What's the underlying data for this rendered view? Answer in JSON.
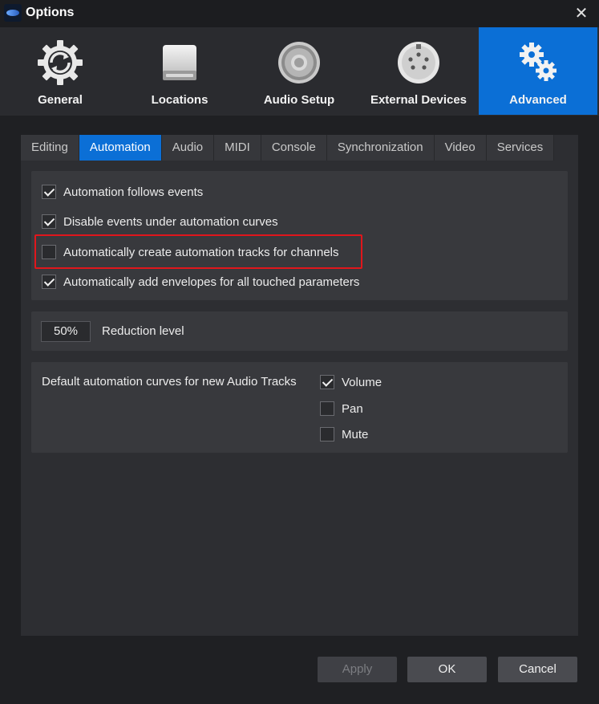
{
  "window": {
    "title": "Options",
    "close_icon": "close-icon"
  },
  "categories": [
    {
      "label": "General",
      "icon": "refresh-gear-icon",
      "active": false
    },
    {
      "label": "Locations",
      "icon": "drive-icon",
      "active": false
    },
    {
      "label": "Audio Setup",
      "icon": "speaker-icon",
      "active": false
    },
    {
      "label": "External Devices",
      "icon": "midi-connector-icon",
      "active": false
    },
    {
      "label": "Advanced",
      "icon": "gears-icon",
      "active": true
    }
  ],
  "tabs": [
    {
      "label": "Editing",
      "active": false
    },
    {
      "label": "Automation",
      "active": true
    },
    {
      "label": "Audio",
      "active": false
    },
    {
      "label": "MIDI",
      "active": false
    },
    {
      "label": "Console",
      "active": false
    },
    {
      "label": "Synchronization",
      "active": false
    },
    {
      "label": "Video",
      "active": false
    },
    {
      "label": "Services",
      "active": false
    }
  ],
  "automation_options": [
    {
      "label": "Automation follows events",
      "checked": true
    },
    {
      "label": "Disable events under automation curves",
      "checked": true
    },
    {
      "label": "Automatically create automation tracks for channels",
      "checked": false
    },
    {
      "label": "Automatically add envelopes for all touched parameters",
      "checked": true
    }
  ],
  "reduction": {
    "value": "50%",
    "label": "Reduction level"
  },
  "default_curves": {
    "label": "Default automation curves for new Audio Tracks",
    "options": [
      {
        "label": "Volume",
        "checked": true
      },
      {
        "label": "Pan",
        "checked": false
      },
      {
        "label": "Mute",
        "checked": false
      }
    ]
  },
  "buttons": {
    "apply": "Apply",
    "ok": "OK",
    "cancel": "Cancel"
  },
  "colors": {
    "accent": "#0b6fd6",
    "highlight_border": "#e0161c"
  }
}
